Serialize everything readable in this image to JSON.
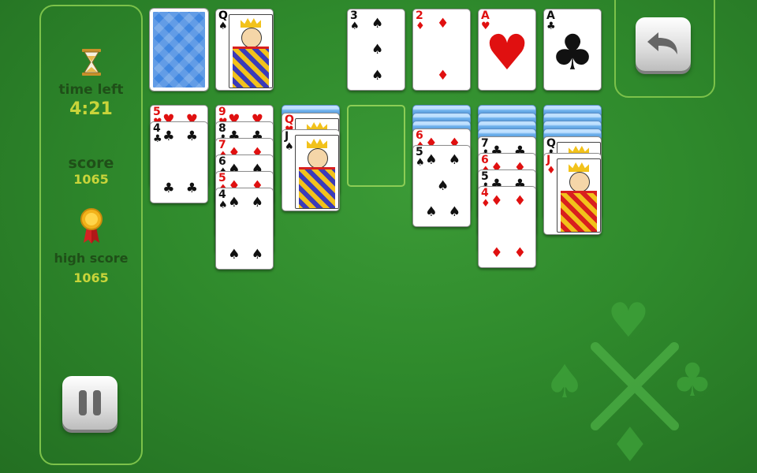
{
  "stats": {
    "time_label": "time left",
    "time_value": "4:21",
    "score_label": "score",
    "score_value": "1065",
    "high_score_label": "high score",
    "high_score_value": "1065"
  },
  "icons": {
    "timer": "hourglass-icon",
    "medal": "medal-icon",
    "undo": "undo-arrow-icon",
    "pause": "pause-icon"
  },
  "colors": {
    "felt": "#2f8a2c",
    "panel_border": "#7cc24a",
    "label": "#1f4f18",
    "value": "#c8d43a"
  },
  "waste_top": {
    "rank": "Q",
    "suit": "♠",
    "color": "black"
  },
  "foundations": [
    {
      "rank": "3",
      "suit": "♠",
      "color": "black"
    },
    {
      "rank": "2",
      "suit": "♦",
      "color": "red"
    },
    {
      "rank": "A",
      "suit": "♥",
      "color": "red"
    },
    {
      "rank": "A",
      "suit": "♣",
      "color": "black"
    }
  ],
  "tableau": [
    {
      "hidden": 0,
      "cards": [
        {
          "rank": "5",
          "suit": "♥",
          "color": "red"
        },
        {
          "rank": "4",
          "suit": "♣",
          "color": "black"
        }
      ]
    },
    {
      "hidden": 0,
      "cards": [
        {
          "rank": "9",
          "suit": "♥",
          "color": "red"
        },
        {
          "rank": "8",
          "suit": "♣",
          "color": "black"
        },
        {
          "rank": "7",
          "suit": "♦",
          "color": "red"
        },
        {
          "rank": "6",
          "suit": "♠",
          "color": "black"
        },
        {
          "rank": "5",
          "suit": "♦",
          "color": "red"
        },
        {
          "rank": "4",
          "suit": "♠",
          "color": "black"
        }
      ]
    },
    {
      "hidden": 1,
      "cards": [
        {
          "rank": "Q",
          "suit": "♥",
          "color": "red"
        },
        {
          "rank": "J",
          "suit": "♠",
          "color": "black"
        }
      ]
    },
    {
      "hidden": 0,
      "cards": []
    },
    {
      "hidden": 3,
      "cards": [
        {
          "rank": "6",
          "suit": "♦",
          "color": "red"
        },
        {
          "rank": "5",
          "suit": "♠",
          "color": "black"
        }
      ]
    },
    {
      "hidden": 4,
      "cards": [
        {
          "rank": "7",
          "suit": "♣",
          "color": "black"
        },
        {
          "rank": "6",
          "suit": "♦",
          "color": "red"
        },
        {
          "rank": "5",
          "suit": "♣",
          "color": "black"
        },
        {
          "rank": "4",
          "suit": "♦",
          "color": "red"
        }
      ]
    },
    {
      "hidden": 4,
      "cards": [
        {
          "rank": "Q",
          "suit": "♣",
          "color": "black"
        },
        {
          "rank": "J",
          "suit": "♦",
          "color": "red"
        }
      ]
    }
  ]
}
